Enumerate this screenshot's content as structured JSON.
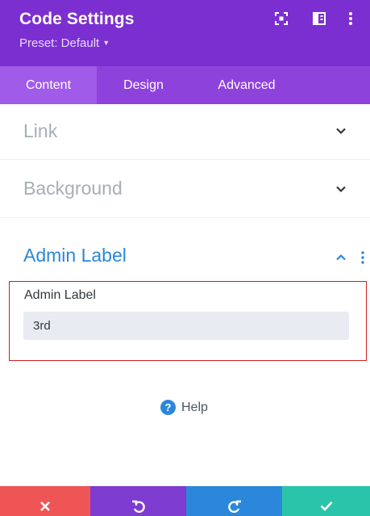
{
  "header": {
    "title": "Code Settings",
    "preset": "Preset: Default",
    "icons": [
      "expand-icon",
      "sidebar-toggle-icon",
      "more-options-icon"
    ]
  },
  "tabs": [
    {
      "label": "Content",
      "active": true
    },
    {
      "label": "Design",
      "active": false
    },
    {
      "label": "Advanced",
      "active": false
    }
  ],
  "sections": {
    "link": {
      "label": "Link",
      "expanded": false
    },
    "background": {
      "label": "Background",
      "expanded": false
    },
    "admin_label": {
      "label": "Admin Label",
      "expanded": true
    }
  },
  "admin_label_field": {
    "label": "Admin Label",
    "value": "3rd"
  },
  "help": {
    "label": "Help"
  },
  "footer": {
    "buttons": [
      {
        "name": "cancel",
        "icon": "close-icon",
        "color": "#ef5555"
      },
      {
        "name": "undo",
        "icon": "undo-icon",
        "color": "#7e3bd0"
      },
      {
        "name": "redo",
        "icon": "redo-icon",
        "color": "#2b87da"
      },
      {
        "name": "save",
        "icon": "check-icon",
        "color": "#29c4a9"
      }
    ]
  },
  "colors": {
    "header": "#7b2fd1",
    "tabs": "#8e42dc",
    "tab_active": "#a05be8",
    "accent_blue": "#2b87da",
    "highlight_border": "#cc1f1f"
  }
}
